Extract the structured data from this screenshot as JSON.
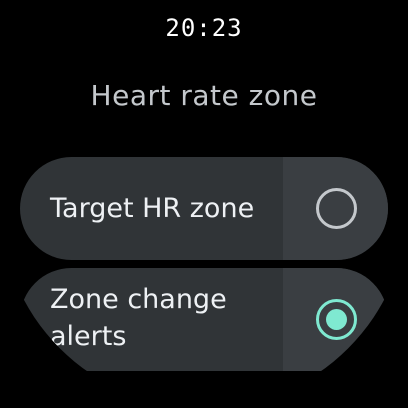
{
  "status_bar": {
    "time": "20:23"
  },
  "header": {
    "title": "Heart rate zone"
  },
  "options": [
    {
      "label": "Target HR zone",
      "selected": false,
      "control_icon": "radio-unselected-icon"
    },
    {
      "label": "Zone change\nalerts",
      "selected": true,
      "control_icon": "radio-selected-icon"
    }
  ],
  "colors": {
    "background": "#000000",
    "chip": "#303437",
    "chip_control_area": "#3a3e42",
    "accent": "#7fe9d1",
    "title_text": "#c4c8cc",
    "label_text": "#eef1f4"
  }
}
